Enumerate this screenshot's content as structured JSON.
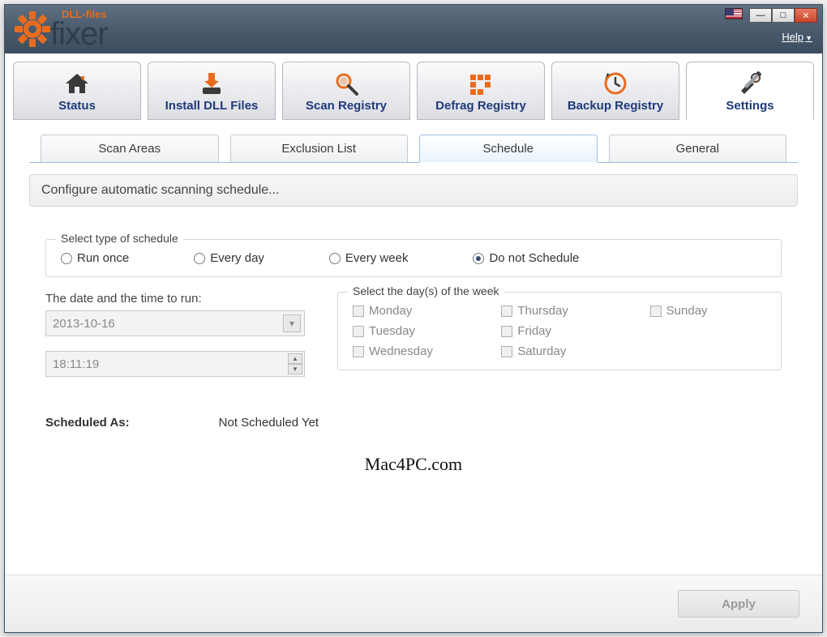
{
  "titlebar": {
    "help_label": "Help",
    "logo_small": "DLL-files",
    "logo_large": "fixer"
  },
  "main_tabs": [
    {
      "label": "Status"
    },
    {
      "label": "Install DLL Files"
    },
    {
      "label": "Scan Registry"
    },
    {
      "label": "Defrag Registry"
    },
    {
      "label": "Backup Registry"
    },
    {
      "label": "Settings"
    }
  ],
  "sub_tabs": [
    {
      "label": "Scan Areas"
    },
    {
      "label": "Exclusion List"
    },
    {
      "label": "Schedule"
    },
    {
      "label": "General"
    }
  ],
  "section_title": "Configure automatic scanning schedule...",
  "schedule_type": {
    "legend": "Select type of schedule",
    "options": [
      {
        "label": "Run once",
        "checked": false
      },
      {
        "label": "Every day",
        "checked": false
      },
      {
        "label": "Every week",
        "checked": false
      },
      {
        "label": "Do not Schedule",
        "checked": true
      }
    ]
  },
  "date_time": {
    "label": "The date and the time to run:",
    "date_value": "2013-10-16",
    "time_value": "18:11:19"
  },
  "days": {
    "legend": "Select the day(s) of the week",
    "list": [
      "Monday",
      "Thursday",
      "Sunday",
      "Tuesday",
      "Friday",
      "Wednesday",
      "Saturday"
    ]
  },
  "scheduled_label": "Scheduled As:",
  "scheduled_value": "Not Scheduled Yet",
  "watermark": "Mac4PC.com",
  "apply_label": "Apply"
}
